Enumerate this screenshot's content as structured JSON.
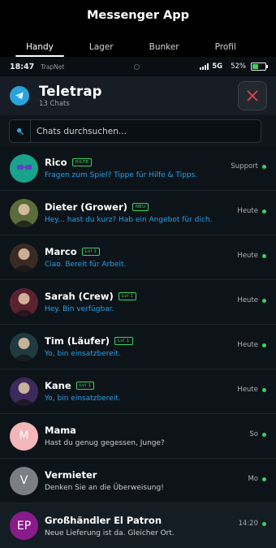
{
  "app": {
    "title": "Messenger App"
  },
  "tabs": [
    {
      "label": "Handy",
      "active": true
    },
    {
      "label": "Lager",
      "active": false
    },
    {
      "label": "Bunker",
      "active": false
    },
    {
      "label": "Profil",
      "active": false
    }
  ],
  "status": {
    "time": "18:47",
    "carrier": "TrapNet",
    "network": "5G",
    "battery": "52%",
    "battery_level": 0.52
  },
  "header": {
    "title": "Teletrap",
    "subtitle": "13 Chats"
  },
  "search": {
    "placeholder": "Chats durchsuchen..."
  },
  "colors": {
    "accent": "#2aa3dd",
    "online": "#3ad35f",
    "message_blue": "#27a0ea",
    "close_red": "#e04646"
  },
  "chats": [
    {
      "name": "Rico",
      "badge": "HILFE",
      "message": "Fragen zum Spiel? Tippe für Hilfe & Tipps.",
      "time": "Support",
      "avatar_icon": "robot-icon",
      "avatar_initials": "",
      "avatar_color": "#1aa38c",
      "msg_color": "blue"
    },
    {
      "name": "Dieter (Grower)",
      "badge": "NEU",
      "message": "Hey... hast du kurz? Hab ein Angebot für dich.",
      "time": "Heute",
      "avatar_icon": "person-photo-icon",
      "avatar_initials": "",
      "avatar_color": "#5b6b3a",
      "msg_color": "blue"
    },
    {
      "name": "Marco",
      "badge": "Lvl 1",
      "message": "Ciao. Bereit für Arbeit.",
      "time": "Heute",
      "avatar_icon": "person-photo-icon",
      "avatar_initials": "",
      "avatar_color": "#3a2a24",
      "msg_color": "blue"
    },
    {
      "name": "Sarah (Crew)",
      "badge": "Lvl 1",
      "message": "Hey. Bin verfügbar.",
      "time": "Heute",
      "avatar_icon": "person-photo-icon",
      "avatar_initials": "",
      "avatar_color": "#5a2230",
      "msg_color": "blue"
    },
    {
      "name": "Tim (Läufer)",
      "badge": "Lvl 1",
      "message": "Yo, bin einsatzbereit.",
      "time": "Heute",
      "avatar_icon": "person-photo-icon",
      "avatar_initials": "",
      "avatar_color": "#1f3a40",
      "msg_color": "blue"
    },
    {
      "name": "Kane",
      "badge": "Lvl 1",
      "message": "Yo, bin einsatzbereit.",
      "time": "Heute",
      "avatar_icon": "person-photo-icon",
      "avatar_initials": "",
      "avatar_color": "#3b2a5c",
      "msg_color": "blue"
    },
    {
      "name": "Mama",
      "badge": "",
      "message": "Hast du genug gegessen, Junge?",
      "time": "So",
      "avatar_icon": "",
      "avatar_initials": "M",
      "avatar_color": "#f4b6b9",
      "msg_color": "gray"
    },
    {
      "name": "Vermieter",
      "badge": "",
      "message": "Denken Sie an die Überweisung!",
      "time": "Mo",
      "avatar_icon": "",
      "avatar_initials": "V",
      "avatar_color": "#7b7f83",
      "msg_color": "gray"
    },
    {
      "name": "Großhändler El Patron",
      "badge": "",
      "message": "Neue Lieferung ist da. Gleicher Ort.",
      "time": "14:20",
      "avatar_icon": "",
      "avatar_initials": "EP",
      "avatar_color": "#8a1b8a",
      "msg_color": "gray"
    }
  ]
}
